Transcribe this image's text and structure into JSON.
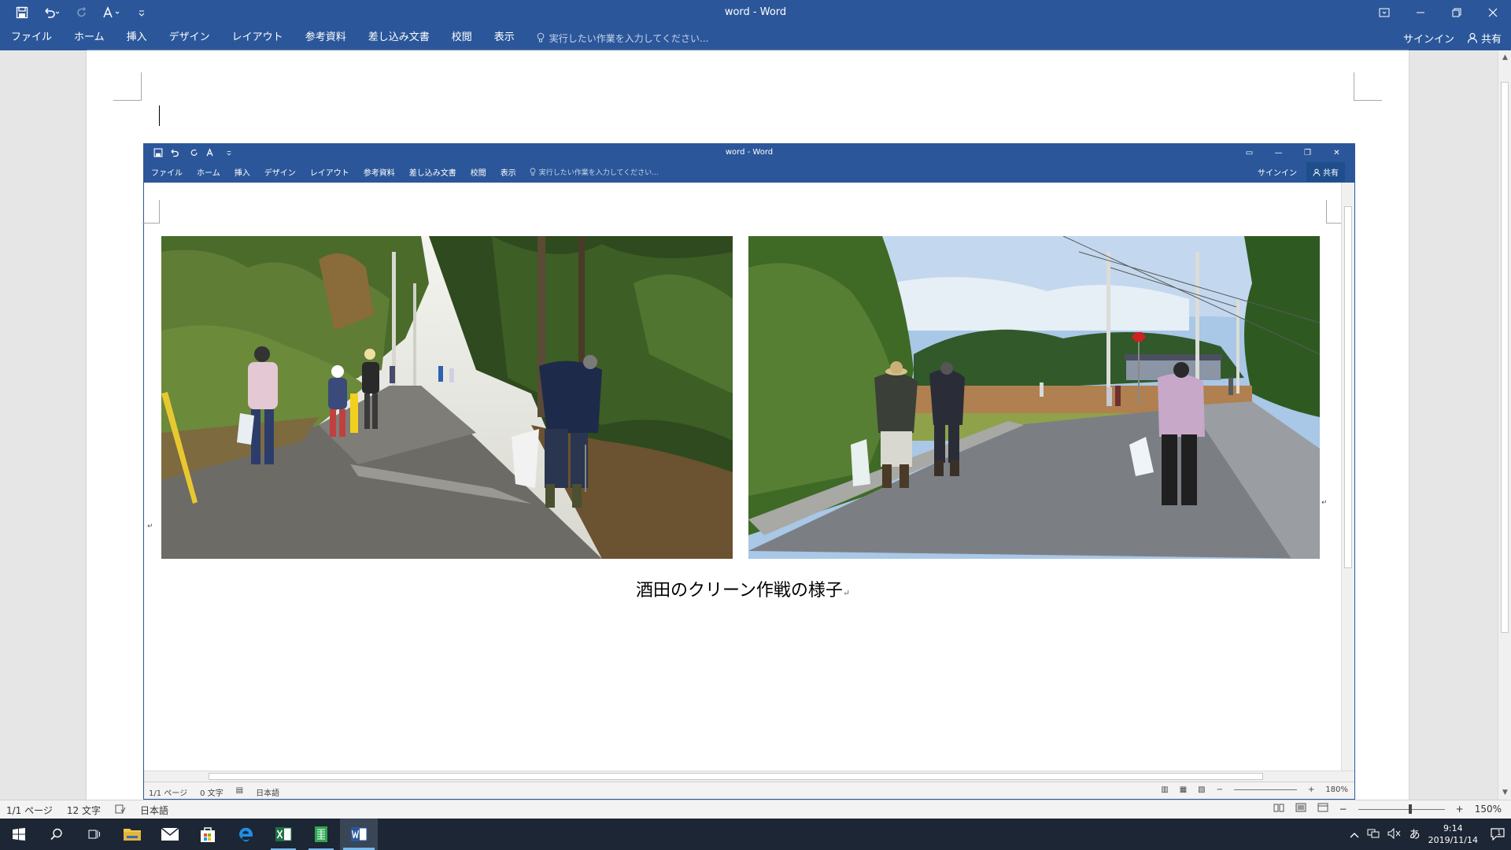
{
  "window": {
    "title": "word - Word",
    "tabs": [
      "ファイル",
      "ホーム",
      "挿入",
      "デザイン",
      "レイアウト",
      "参考資料",
      "差し込み文書",
      "校閲",
      "表示"
    ],
    "tell_me_placeholder": "実行したい作業を入力してください...",
    "signin": "サインイン",
    "share": "共有"
  },
  "inner": {
    "title": "word - Word",
    "tabs": [
      "ファイル",
      "ホーム",
      "挿入",
      "デザイン",
      "レイアウト",
      "参考資料",
      "差し込み文書",
      "校閲",
      "表示"
    ],
    "tell_me_placeholder": "実行したい作業を入力してください...",
    "signin": "サインイン",
    "share": "共有",
    "caption": "酒田のクリーン作戦の様子",
    "status": {
      "page": "1/1 ページ",
      "words": "0 文字",
      "language": "日本語",
      "zoom": "180%"
    }
  },
  "status": {
    "page": "1/1 ページ",
    "words": "12 文字",
    "language": "日本語",
    "zoom": "150%",
    "zoom_level_percent": 150
  },
  "taskbar": {
    "time": "9:14",
    "date": "2019/11/14",
    "ime": "あ",
    "notification_count": "1"
  },
  "colors": {
    "word_blue": "#2b579a",
    "taskbar": "#1d2634"
  }
}
